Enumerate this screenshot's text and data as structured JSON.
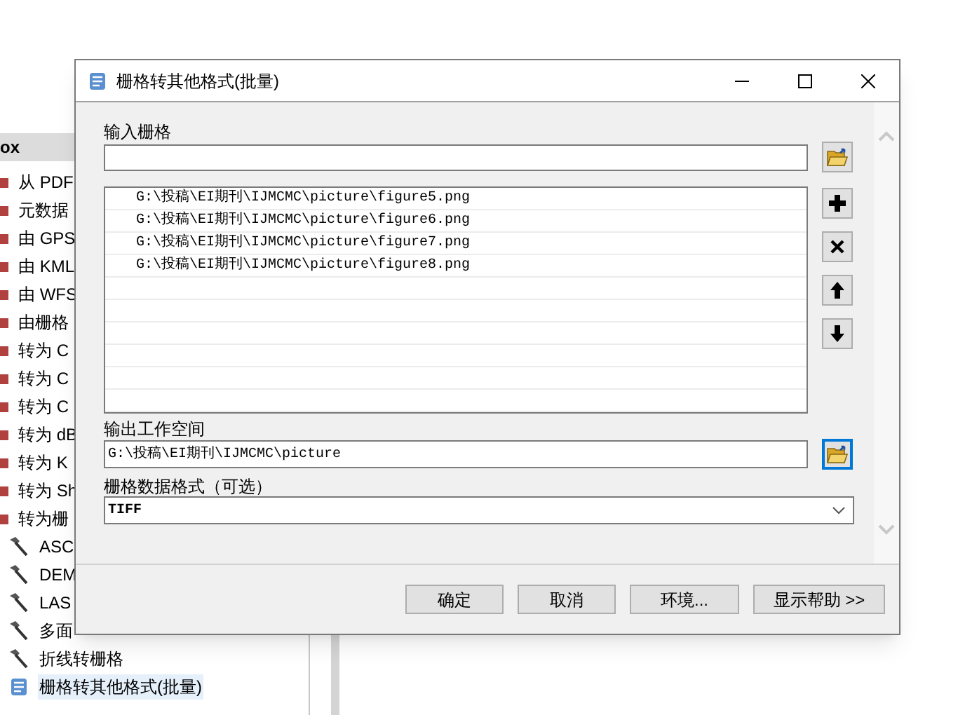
{
  "toolbox_panel": {
    "header": "ox",
    "items": [
      {
        "label": "从 PDF",
        "kind": "toolset",
        "selected": false
      },
      {
        "label": "元数据",
        "kind": "toolset",
        "selected": false
      },
      {
        "label": "由 GPS",
        "kind": "toolset",
        "selected": false
      },
      {
        "label": "由 KML",
        "kind": "toolset",
        "selected": false
      },
      {
        "label": "由 WFS",
        "kind": "toolset",
        "selected": false
      },
      {
        "label": "由栅格",
        "kind": "toolset",
        "selected": false
      },
      {
        "label": "转为 C",
        "kind": "toolset",
        "selected": false
      },
      {
        "label": "转为 C",
        "kind": "toolset",
        "selected": false
      },
      {
        "label": "转为 C",
        "kind": "toolset",
        "selected": false
      },
      {
        "label": "转为 dB",
        "kind": "toolset",
        "selected": false
      },
      {
        "label": "转为 K",
        "kind": "toolset",
        "selected": false
      },
      {
        "label": "转为 Sh",
        "kind": "toolset",
        "selected": false
      },
      {
        "label": "转为栅",
        "kind": "toolset",
        "selected": false
      },
      {
        "label": "ASC",
        "kind": "tool",
        "selected": false
      },
      {
        "label": "DEM",
        "kind": "tool",
        "selected": false
      },
      {
        "label": "LAS",
        "kind": "tool",
        "selected": false
      },
      {
        "label": "多面",
        "kind": "tool",
        "selected": false
      },
      {
        "label": "折线转栅格",
        "kind": "tool",
        "selected": false
      },
      {
        "label": "栅格转其他格式(批量)",
        "kind": "script",
        "selected": true
      }
    ]
  },
  "dialog": {
    "title": "栅格转其他格式(批量)",
    "input_raster": {
      "label": "输入栅格",
      "focused": false,
      "list": [
        "G:\\投稿\\EI期刊\\IJMCMC\\picture\\figure5.png",
        "G:\\投稿\\EI期刊\\IJMCMC\\picture\\figure6.png",
        "G:\\投稿\\EI期刊\\IJMCMC\\picture\\figure7.png",
        "G:\\投稿\\EI期刊\\IJMCMC\\picture\\figure8.png"
      ]
    },
    "output_workspace": {
      "label": "输出工作空间",
      "value": "G:\\投稿\\EI期刊\\IJMCMC\\picture",
      "focused": true
    },
    "raster_format": {
      "label": "栅格数据格式（可选）",
      "value": "TIFF"
    },
    "buttons": [
      "确定",
      "取消",
      "环境...",
      "显示帮助 >>"
    ]
  }
}
